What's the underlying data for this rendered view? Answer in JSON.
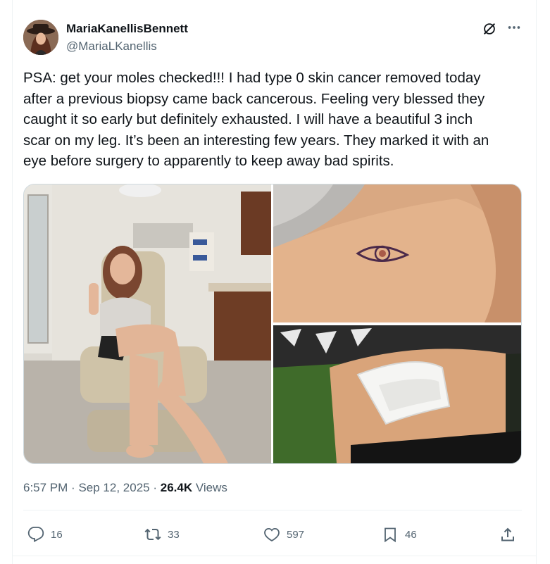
{
  "author": {
    "display_name": "MariaKanellisBennett",
    "handle": "@MariaLKanellis"
  },
  "tweet": {
    "text_lines": [
      "PSA: get your moles checked!!! I had type 0 skin cancer removed today",
      "after a previous biopsy came back cancerous. Feeling very blessed they",
      "caught it so early but definitely exhausted. I will have a beautiful 3 inch",
      "scar on my leg. It’s been an interesting few years. They marked it with an",
      "eye before surgery to apparently to keep away bad spirits."
    ],
    "time": "6:57 PM",
    "date": "Sep 12, 2025",
    "views_count": "26.4K",
    "views_label": "Views",
    "separator": "·"
  },
  "media": [
    {
      "kind": "photo",
      "subject": "woman in exam chair giving peace sign"
    },
    {
      "kind": "photo",
      "subject": "eye marking drawn on leg"
    },
    {
      "kind": "photo",
      "subject": "bandage on leg"
    }
  ],
  "actions": {
    "replies": "16",
    "reposts": "33",
    "likes": "597",
    "bookmarks": "46"
  },
  "icons": {
    "grok": "grok-icon",
    "more": "more-icon",
    "reply": "reply-icon",
    "repost": "repost-icon",
    "like": "heart-icon",
    "bookmark": "bookmark-icon",
    "share": "share-icon"
  },
  "colors": {
    "text_primary": "#0f1419",
    "text_secondary": "#536471",
    "border": "#eff3f4"
  }
}
